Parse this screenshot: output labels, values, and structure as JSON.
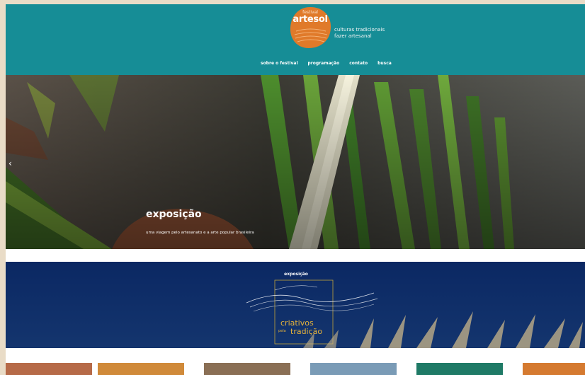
{
  "header": {
    "logo_festival": "festival",
    "logo_name": "artesol",
    "tagline_line1": "culturas tradicionais",
    "tagline_line2": "fazer artesanal",
    "nav": [
      {
        "label": "sobre o festival"
      },
      {
        "label": "programação"
      },
      {
        "label": "contato"
      },
      {
        "label": "busca"
      }
    ],
    "colors": {
      "bar": "#168d96",
      "logo": "#e07a2a"
    }
  },
  "hero": {
    "title": "exposição",
    "subtitle": "uma viagem pelo artesanato e a arte popular brasileira",
    "prev_icon": "chevron-left-icon"
  },
  "banner": {
    "label": "exposição",
    "title_line1": "criativos",
    "title_small": "pela",
    "title_line2": "tradição",
    "colors": {
      "bg": "#0d2a62",
      "accent": "#e5b23a"
    }
  },
  "thumbnails": [
    {
      "name": "thumb-portrait",
      "color": "#b66a48"
    },
    {
      "name": "thumb-workshop",
      "color": "#d08a3a"
    },
    {
      "name": "thumb-market",
      "color": "#8a6f55"
    },
    {
      "name": "thumb-crafts",
      "color": "#7a9bb6"
    },
    {
      "name": "thumb-green",
      "color": "#1f7a66"
    },
    {
      "name": "thumb-orange",
      "color": "#d57a30"
    }
  ]
}
